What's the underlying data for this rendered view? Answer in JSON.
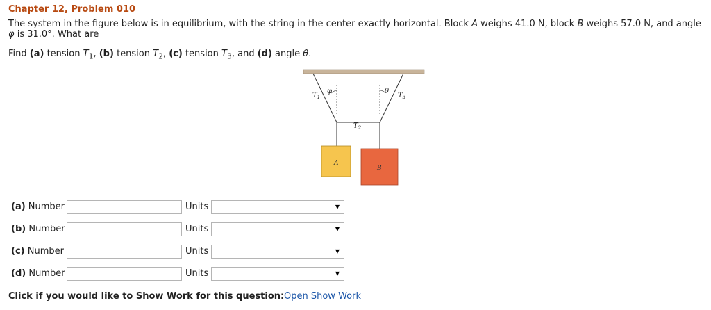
{
  "problem": {
    "title": "Chapter 12, Problem 010",
    "statement_1": "The system in the figure below is in equilibrium, with the string in the center exactly horizontal. Block ",
    "block_a": "A",
    "statement_2": " weighs 41.0 N, block ",
    "block_b": "B",
    "statement_3": " weighs 57.0 N, and angle ",
    "phi": "φ",
    "statement_4": " is 31.0°. What are"
  },
  "find": {
    "prefix": "Find ",
    "a": "(a)",
    "a_text": " tension ",
    "t1": "T",
    "t1_sub": "1",
    "sep_b": ", ",
    "b": "(b)",
    "b_text": " tension ",
    "t2": "T",
    "t2_sub": "2",
    "sep_c": ", ",
    "c": "(c)",
    "c_text": " tension ",
    "t3": "T",
    "t3_sub": "3",
    "sep_d": ", and ",
    "d": "(d)",
    "d_text": " angle ",
    "theta": "θ",
    "end": "."
  },
  "figure": {
    "label_t1": "T",
    "label_t1_sub": "1",
    "label_phi": "φ",
    "label_t2": "T",
    "label_t2_sub": "2",
    "label_theta": "θ",
    "label_t3": "T",
    "label_t3_sub": "3",
    "block_a_label": "A",
    "block_b_label": "B",
    "colors": {
      "ceiling": "#c8b49a",
      "block_a": "#f6c54e",
      "block_b": "#e8673f",
      "string": "#333333"
    }
  },
  "answers": [
    {
      "part": "(a)",
      "label": "Number",
      "value": "",
      "units_label": "Units",
      "units_value": ""
    },
    {
      "part": "(b)",
      "label": "Number",
      "value": "",
      "units_label": "Units",
      "units_value": ""
    },
    {
      "part": "(c)",
      "label": "Number",
      "value": "",
      "units_label": "Units",
      "units_value": ""
    },
    {
      "part": "(d)",
      "label": "Number",
      "value": "",
      "units_label": "Units",
      "units_value": ""
    }
  ],
  "show_work": {
    "prompt": "Click if you would like to Show Work for this question:",
    "link": "Open Show Work"
  },
  "dropdown_arrow": "▼"
}
